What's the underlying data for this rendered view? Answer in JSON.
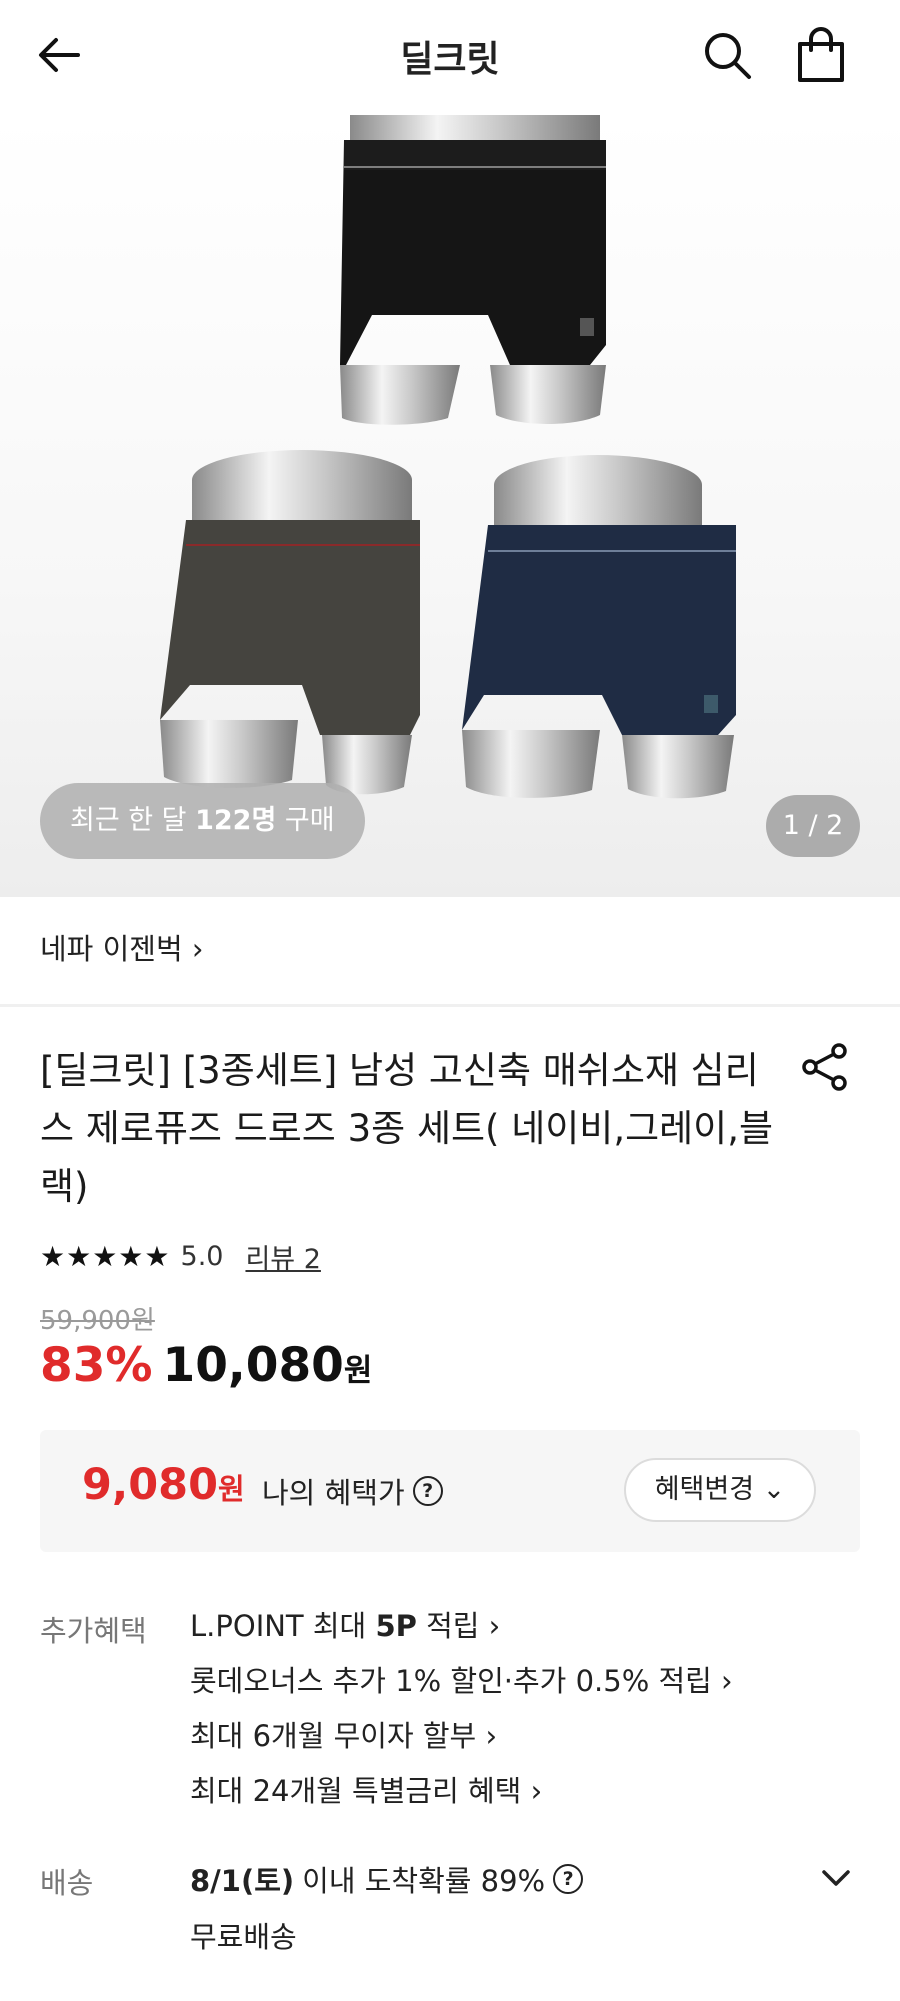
{
  "header": {
    "title": "딜크릿",
    "back_icon": "arrow-left-icon",
    "search_icon": "search-icon",
    "cart_icon": "shopping-bag-icon"
  },
  "hero": {
    "recent_prefix": "최근 한 달 ",
    "recent_count": "122명",
    "recent_suffix": " 구매",
    "page_indicator": "1 / 2"
  },
  "brand": {
    "name": "네파 이젠벅",
    "chevron": "›"
  },
  "product": {
    "title": "[딜크릿] [3종세트] 남성 고신축 매쉬소재 심리스 제로퓨즈 드로즈 3종 세트( 네이비,그레이,블랙)",
    "share_icon": "share-icon"
  },
  "rating": {
    "stars": "★★★★★",
    "score": "5.0",
    "review_link": "리뷰 2"
  },
  "price": {
    "original": "59,900원",
    "discount": "83%",
    "sale": "10,080",
    "currency": "원"
  },
  "benefit": {
    "price": "9,080",
    "currency": "원",
    "label": "나의 혜택가",
    "help": "?",
    "change_button": "혜택변경 ⌄"
  },
  "extra_benefits": {
    "label": "추가혜택",
    "items": [
      {
        "pre": "L.POINT 최대 ",
        "bold": "5P",
        "post": " 적립 ›"
      },
      {
        "pre": "롯데오너스 추가 1% 할인·추가 0.5% 적립 ›",
        "bold": "",
        "post": ""
      },
      {
        "pre": "최대 6개월 무이자 할부 ›",
        "bold": "",
        "post": ""
      },
      {
        "pre": "최대 24개월 특별금리 혜택 ›",
        "bold": "",
        "post": ""
      }
    ]
  },
  "shipping": {
    "label": "배송",
    "date": "8/1(토)",
    "desc": "이내 도착확률 89%",
    "help": "?",
    "sub": "무료배송"
  },
  "colors": {
    "accent_red": "#e02b2b",
    "text_dark": "#1a1a1a",
    "muted": "#777777"
  }
}
